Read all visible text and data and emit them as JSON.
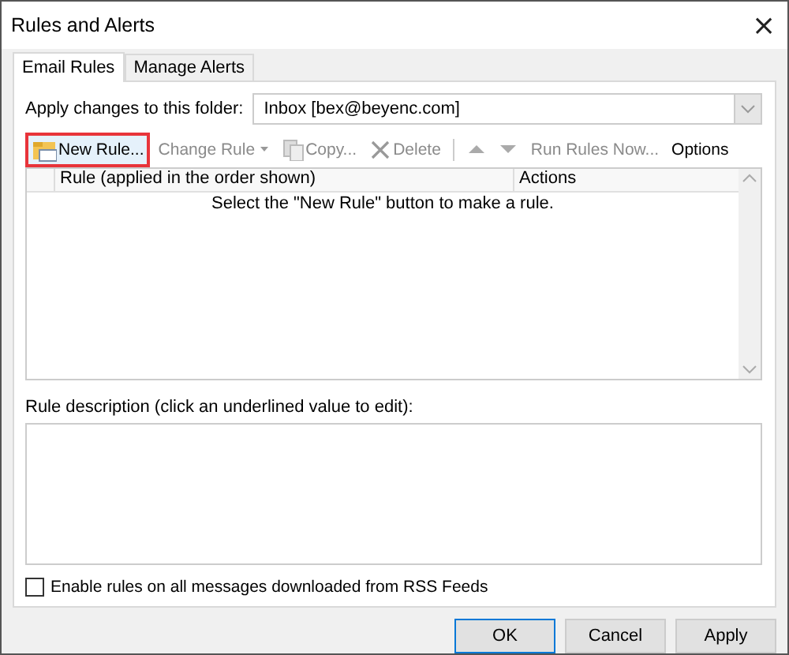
{
  "window": {
    "title": "Rules and Alerts",
    "close": "×"
  },
  "tabs": [
    {
      "label": "Email Rules",
      "selected": true
    },
    {
      "label": "Manage Alerts",
      "selected": false
    }
  ],
  "folder": {
    "label": "Apply changes to this folder:",
    "value": "Inbox [bex@beyenc.com]"
  },
  "toolbar": [
    {
      "kind": "new",
      "label": "New Rule...",
      "disabled": false,
      "highlighted": true
    },
    {
      "kind": "change",
      "label": "Change Rule",
      "disabled": true,
      "highlighted": false
    },
    {
      "kind": "copy",
      "label": "Copy...",
      "disabled": true,
      "highlighted": false
    },
    {
      "kind": "delete",
      "label": "Delete",
      "disabled": true,
      "highlighted": false
    },
    {
      "kind": "up",
      "disabled": true,
      "highlighted": false
    },
    {
      "kind": "down",
      "disabled": true,
      "highlighted": false
    },
    {
      "kind": "run",
      "label": "Run Rules Now...",
      "disabled": true,
      "highlighted": false
    },
    {
      "kind": "options",
      "label": "Options",
      "disabled": false,
      "highlighted": false
    }
  ],
  "table": {
    "columns": [
      "Rule (applied in the order shown)",
      "Actions"
    ],
    "empty_message": "Select the \"New Rule\" button to make a rule."
  },
  "description": {
    "label": "Rule description (click an underlined value to edit):"
  },
  "rss": {
    "label": "Enable rules on all messages downloaded from RSS Feeds",
    "checked": false
  },
  "buttons": [
    {
      "label": "OK",
      "default": true
    },
    {
      "label": "Cancel",
      "default": false
    },
    {
      "label": "Apply",
      "default": false
    }
  ]
}
